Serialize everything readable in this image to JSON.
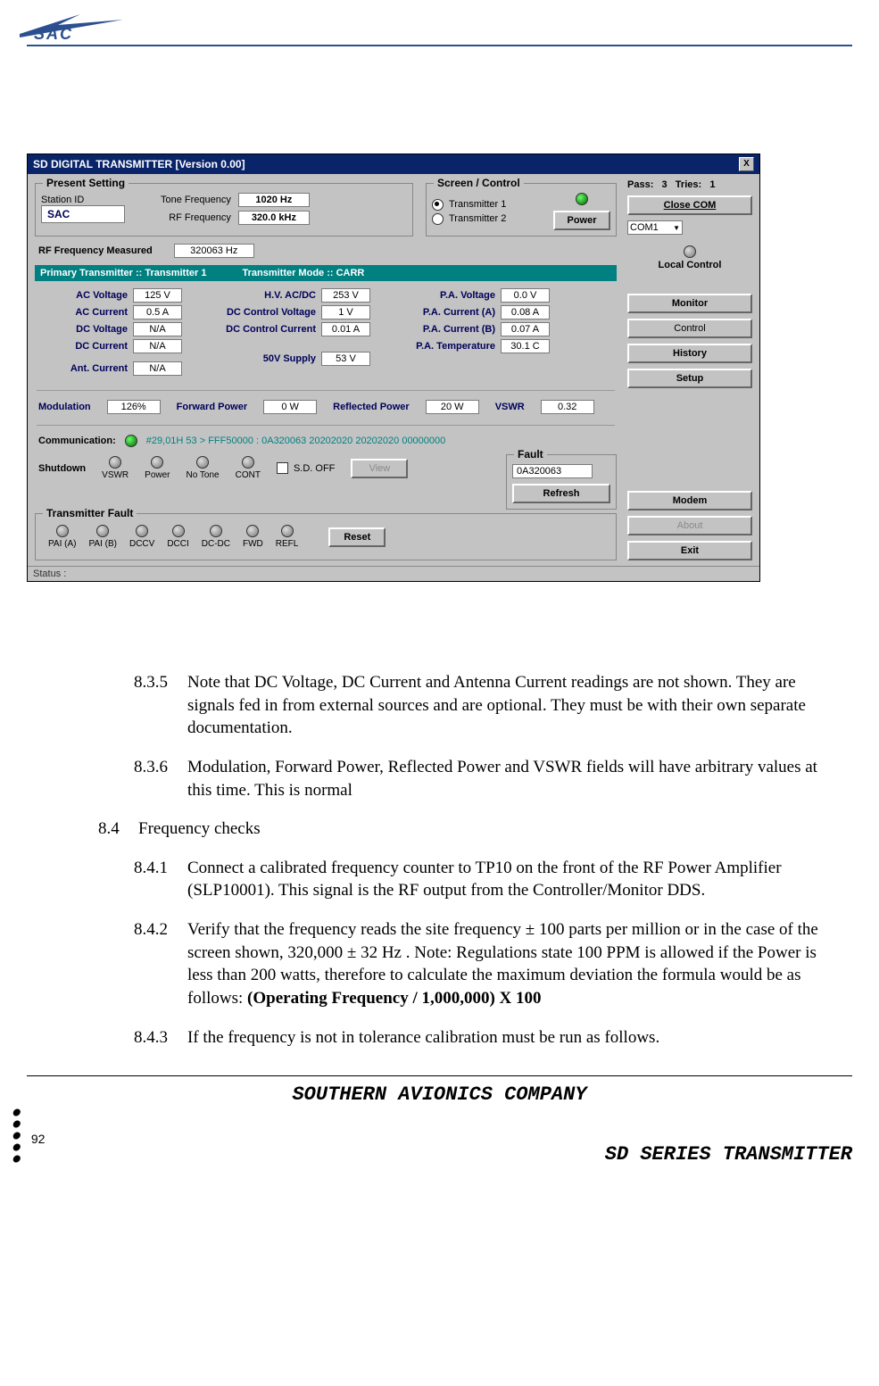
{
  "header": {
    "logo_alt": "SAC logo"
  },
  "app": {
    "title": "SD DIGITAL TRANSMITTER   [Version 0.00]",
    "close_x": "X",
    "present_setting": {
      "legend": "Present Setting",
      "station_id_label": "Station ID",
      "station_id_value": "SAC",
      "tone_freq_label": "Tone Frequency",
      "tone_freq_value": "1020 Hz",
      "rf_freq_label": "RF Frequency",
      "rf_freq_value": "320.0 kHz"
    },
    "screen_control": {
      "legend": "Screen / Control",
      "tx1": "Transmitter 1",
      "tx2": "Transmitter 2",
      "power_btn": "Power"
    },
    "rf_measured_label": "RF Frequency Measured",
    "rf_measured_value": "320063 Hz",
    "band": {
      "primary": "Primary Transmitter :: Transmitter 1",
      "mode": "Transmitter Mode :: CARR"
    },
    "meas_left": {
      "ac_voltage_l": "AC Voltage",
      "ac_voltage_v": "125 V",
      "ac_current_l": "AC Current",
      "ac_current_v": "0.5 A",
      "dc_voltage_l": "DC Voltage",
      "dc_voltage_v": "N/A",
      "dc_current_l": "DC Current",
      "dc_current_v": "N/A",
      "ant_current_l": "Ant. Current",
      "ant_current_v": "N/A"
    },
    "meas_mid": {
      "hv_l": "H.V. AC/DC",
      "hv_v": "253 V",
      "dcv_l": "DC Control Voltage",
      "dcv_v": "1 V",
      "dcc_l": "DC Control Current",
      "dcc_v": "0.01 A",
      "s50_l": "50V Supply",
      "s50_v": "53 V"
    },
    "meas_right": {
      "pav_l": "P.A. Voltage",
      "pav_v": "0.0 V",
      "paca_l": "P.A. Current (A)",
      "paca_v": "0.08 A",
      "pacb_l": "P.A. Current (B)",
      "pacb_v": "0.07 A",
      "pat_l": "P.A. Temperature",
      "pat_v": "30.1 C"
    },
    "modrow": {
      "mod_l": "Modulation",
      "mod_v": "126%",
      "fwd_l": "Forward Power",
      "fwd_v": "0 W",
      "ref_l": "Reflected Power",
      "ref_v": "20 W",
      "vswr_l": "VSWR",
      "vswr_v": "0.32"
    },
    "comm": {
      "label": "Communication:",
      "text": "#29,01H 53 > FFF50000 : 0A320063 20202020 20202020 00000000"
    },
    "shutdown": {
      "label": "Shutdown",
      "items": [
        "VSWR",
        "Power",
        "No Tone",
        "CONT"
      ],
      "sd_off": "S.D. OFF",
      "view": "View"
    },
    "fault": {
      "legend": "Fault",
      "value": "0A320063",
      "refresh": "Refresh"
    },
    "tfault": {
      "legend": "Transmitter Fault",
      "items": [
        "PAI (A)",
        "PAI (B)",
        "DCCV",
        "DCCI",
        "DC-DC",
        "FWD",
        "REFL"
      ],
      "reset": "Reset"
    },
    "status": "Status :",
    "side": {
      "pass_label": "Pass:   3   Tries:   1",
      "close_com": "Close COM",
      "com_sel": "COM1",
      "local_ctrl": "Local Control",
      "monitor": "Monitor",
      "control": "Control",
      "history": "History",
      "setup": "Setup",
      "modem": "Modem",
      "about": "About",
      "exit": "Exit"
    }
  },
  "doc": {
    "p835_num": "8.3.5",
    "p835_text": "Note that DC Voltage, DC Current and Antenna Current readings are not shown. They are signals fed in from external sources and are optional. They must be with their own separate documentation.",
    "p836_num": "8.3.6",
    "p836_text": "Modulation, Forward Power, Reflected Power and VSWR fields will have arbitrary values at this time. This is normal",
    "p84_num": "8.4",
    "p84_text": "Frequency checks",
    "p841_num": "8.4.1",
    "p841_text": "Connect a calibrated  frequency counter to TP10 on the front of the RF Power Amplifier (SLP10001). This signal is the RF output from the Controller/Monitor DDS.",
    "p842_num": "8.4.2",
    "p842_text_a": "Verify that the frequency reads the site frequency ± 100 parts per million or in the case of the screen shown, 320,000 ± 32 Hz . Note: Regulations state 100 PPM is allowed if the Power is less than 200 watts, therefore to calculate the maximum deviation the formula would be as follows: ",
    "p842_text_b": "(Operating Frequency / 1,000,000) X 100",
    "p843_num": "8.4.3",
    "p843_text": "If the frequency is not in tolerance calibration must be run as follows."
  },
  "footer": {
    "company": "SOUTHERN AVIONICS COMPANY",
    "product": "SD SERIES TRANSMITTER",
    "page": "92"
  }
}
